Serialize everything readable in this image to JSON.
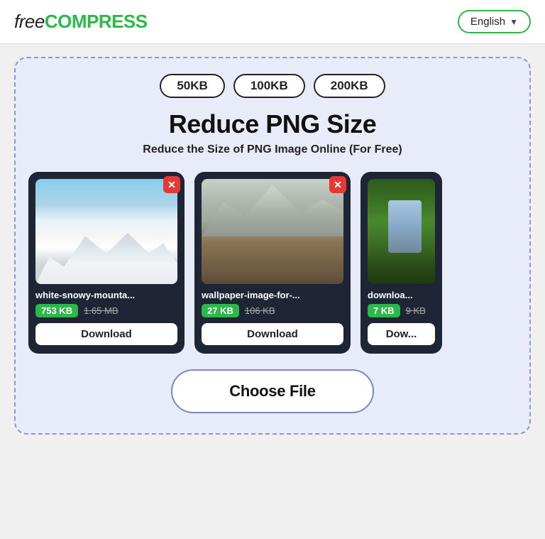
{
  "header": {
    "logo_free": "free",
    "logo_compress": "COMPRESS",
    "lang_label": "English",
    "lang_chevron": "▼"
  },
  "main": {
    "size_pills": [
      "50KB",
      "100KB",
      "200KB"
    ],
    "title": "Reduce PNG Size",
    "subtitle": "Reduce the Size of PNG Image Online (For Free)",
    "cards": [
      {
        "filename": "white-snowy-mounta...",
        "size_reduced": "753 KB",
        "size_original": "1.65 MB",
        "download_label": "Download",
        "image_type": "snow-mountain"
      },
      {
        "filename": "wallpaper-image-for-...",
        "size_reduced": "27 KB",
        "size_original": "106 KB",
        "download_label": "Download",
        "image_type": "mountain-painting"
      },
      {
        "filename": "downloa...",
        "size_reduced": "7 KB",
        "size_original": "9 KB",
        "download_label": "Dow...",
        "image_type": "forest"
      }
    ],
    "choose_file_label": "Choose File"
  }
}
